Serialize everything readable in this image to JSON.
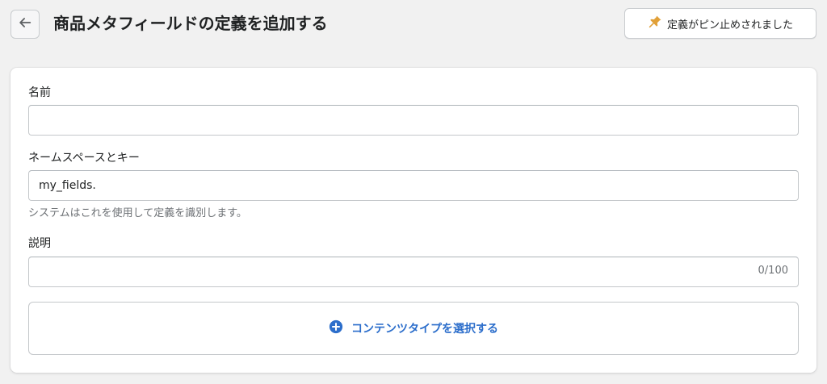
{
  "header": {
    "back_icon": "arrow-left-icon",
    "title": "商品メタフィールドの定義を追加する",
    "pin_button": {
      "icon": "pin-icon",
      "icon_color": "#e1a038",
      "label": "定義がピン止めされました"
    }
  },
  "form": {
    "name": {
      "label": "名前",
      "value": ""
    },
    "namespace": {
      "label": "ネームスペースとキー",
      "value": "my_fields.",
      "help": "システムはこれを使用して定義を識別します。"
    },
    "description": {
      "label": "説明",
      "value": "",
      "counter": "0/100"
    },
    "content_type": {
      "icon": "plus-circle-icon",
      "label": "コンテンツタイプを選択する",
      "color": "#2c6ecb"
    }
  }
}
